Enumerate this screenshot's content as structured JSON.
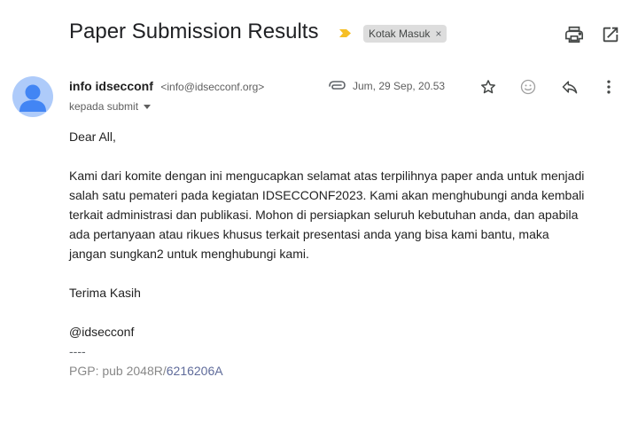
{
  "email": {
    "subject": "Paper Submission Results",
    "label": "Kotak Masuk",
    "label_remove": "×",
    "sender_name": "info idsecconf",
    "sender_email": "<info@idsecconf.org>",
    "recipient": "kepada submit",
    "date": "Jum, 29 Sep, 20.53"
  },
  "body": {
    "greeting": "Dear All,",
    "paragraph_lines": [
      "Kami dari komite dengan ini mengucapkan selamat atas terpilihnya paper anda untuk menjadi",
      "salah satu pemateri pada kegiatan IDSECCONF2023. Kami akan menghubungi anda kembali",
      "terkait administrasi dan publikasi. Mohon di persiapkan seluruh kebutuhan anda, dan apabila",
      "ada pertanyaan atau rikues khusus terkait presentasi anda yang bisa kami bantu, maka",
      "jangan sungkan2 untuk menghubungi kami."
    ],
    "closing": "Terima Kasih",
    "signature": "@idsecconf",
    "sig_separator": "----",
    "pgp_prefix": "PGP: pub 2048R/",
    "pgp_key": "6216206A"
  },
  "icons": {
    "importance": "importance-marker-icon",
    "print": "print-icon",
    "popout": "open-in-new-window-icon",
    "attachment": "attachment-icon",
    "star": "star-icon",
    "emoji": "emoji-reaction-icon",
    "reply": "reply-icon",
    "more": "more-vert-icon"
  },
  "colors": {
    "importance": "#f6bf26",
    "label_bg": "#dddddd",
    "avatar_bg": "#aecbfa",
    "avatar_fg": "#4285f4",
    "pgp_link": "#5f6b9a"
  }
}
